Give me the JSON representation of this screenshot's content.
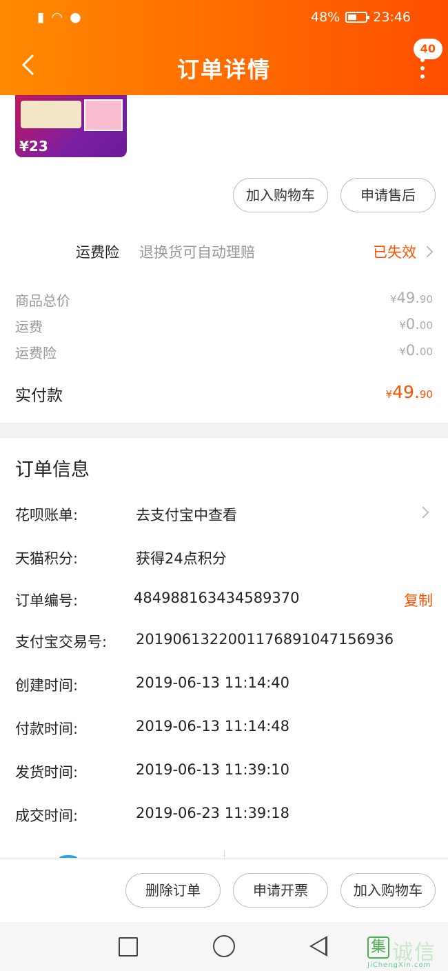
{
  "status_bar": {
    "battery_percent_text": "48%",
    "battery_level": 0.48,
    "time": "23:46"
  },
  "nav": {
    "title": "订单详情",
    "badge": "40"
  },
  "product": {
    "thumb_price": "¥23",
    "actions": [
      "加入购物车",
      "申请售后"
    ]
  },
  "insurance": {
    "label": "运费险",
    "desc": "退换货可自动理赔",
    "status": "已失效"
  },
  "prices": [
    {
      "label": "商品总价",
      "currency": "¥",
      "integer": "49.",
      "decimal": "90"
    },
    {
      "label": "运费",
      "currency": "¥",
      "integer": "0.",
      "decimal": "00"
    },
    {
      "label": "运费险",
      "currency": "¥",
      "integer": "0.",
      "decimal": "00"
    }
  ],
  "paid": {
    "label": "实付款",
    "currency": "¥",
    "integer": "49.",
    "decimal": "90"
  },
  "order_info": {
    "title": "订单信息",
    "rows": [
      {
        "key": "花呗账单:",
        "value": "去支付宝中查看"
      },
      {
        "key": "天猫积分:",
        "value": "获得24点积分"
      },
      {
        "key": "订单编号:",
        "value": "484988163434589370",
        "action": "复制"
      },
      {
        "key": "支付宝交易号:",
        "value": "2019061322001176891047156936"
      },
      {
        "key": "创建时间:",
        "value": "2019-06-13 11:14:40"
      },
      {
        "key": "付款时间:",
        "value": "2019-06-13 11:14:48"
      },
      {
        "key": "发货时间:",
        "value": "2019-06-13 11:39:10"
      },
      {
        "key": "成交时间:",
        "value": "2019-06-23 11:39:18"
      }
    ]
  },
  "bottom_actions": [
    "删除订单",
    "申请开票",
    "加入购物车"
  ],
  "watermark": {
    "logo": "集",
    "text": "诚信",
    "sub": "JiChengXin.com"
  },
  "colors": {
    "accent": "#ff5000",
    "header_start": "#ff8a00",
    "header_end": "#ff4e00"
  }
}
